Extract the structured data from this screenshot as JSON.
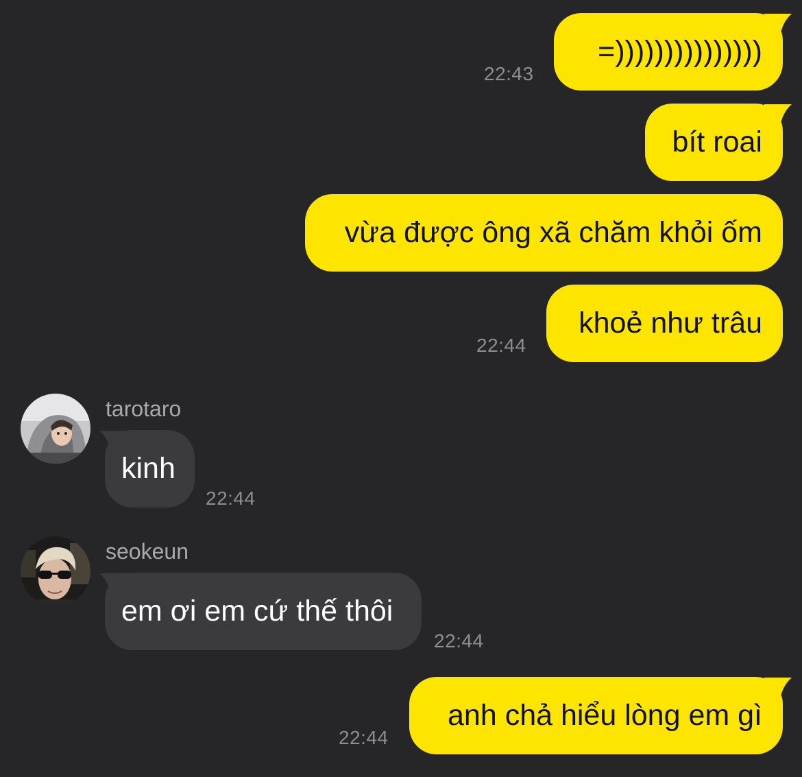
{
  "colors": {
    "background": "#262628",
    "outgoing_bubble": "#fee500",
    "incoming_bubble": "#3b3b3d",
    "timestamp": "#8e8e90",
    "sender_name": "#a9a9ab"
  },
  "messages": [
    {
      "direction": "outgoing",
      "text": "=)))))))))))))))",
      "time": "22:43"
    },
    {
      "direction": "outgoing",
      "text": "bít roai",
      "time": ""
    },
    {
      "direction": "outgoing",
      "text": "vừa được ông xã chăm khỏi ốm",
      "time": ""
    },
    {
      "direction": "outgoing",
      "text": "khoẻ như trâu",
      "time": "22:44"
    },
    {
      "direction": "incoming",
      "sender": "tarotaro",
      "avatar_icon": "user-avatar-hoodie",
      "text": "kinh",
      "time": "22:44"
    },
    {
      "direction": "incoming",
      "sender": "seokeun",
      "avatar_icon": "user-avatar-sunglasses",
      "text": "em ơi em cứ thế thôi",
      "time": "22:44"
    },
    {
      "direction": "outgoing",
      "text": "anh chả hiểu lòng em gì",
      "time": "22:44"
    }
  ]
}
